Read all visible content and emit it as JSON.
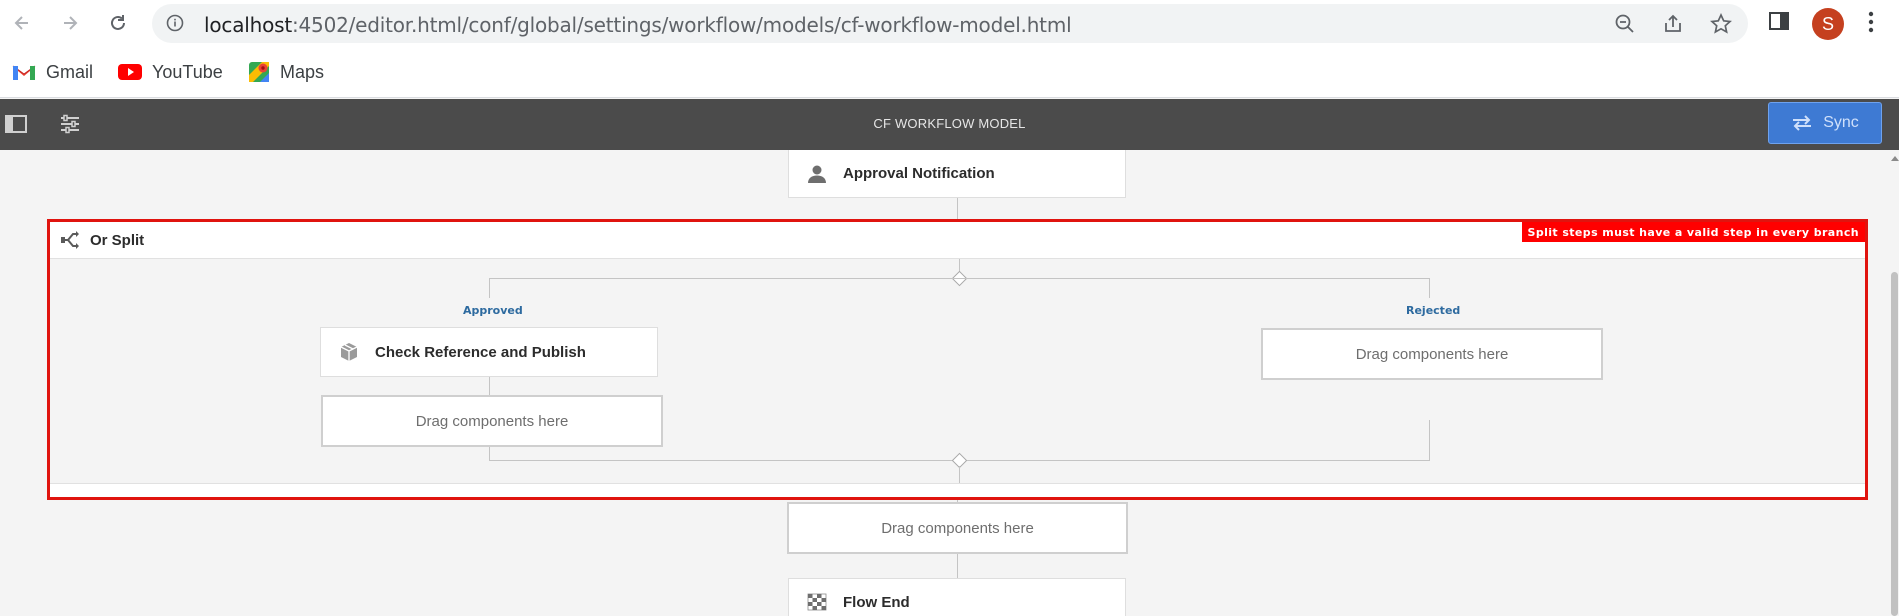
{
  "browser": {
    "url_host": "localhost",
    "url_path": ":4502/editor.html/conf/global/settings/workflow/models/cf-workflow-model.html",
    "avatar_letter": "S",
    "bookmarks": [
      {
        "label": "Gmail",
        "icon": "gmail-icon"
      },
      {
        "label": "YouTube",
        "icon": "youtube-icon"
      },
      {
        "label": "Maps",
        "icon": "maps-icon"
      }
    ]
  },
  "toolbar": {
    "title": "CF WORKFLOW MODEL",
    "sync_label": "Sync",
    "accent": "#3e7ad3"
  },
  "workflow": {
    "approval_step": {
      "label": "Approval Notification",
      "icon": "user-icon"
    },
    "or_split": {
      "label": "Or Split",
      "icon": "split-icon",
      "error": "Split steps must have a valid step in every branch",
      "error_color": "#ff0000",
      "branches": [
        {
          "label": "Approved",
          "step": "Check Reference and Publish",
          "step_icon": "package-icon",
          "drop_label": "Drag components here"
        },
        {
          "label": "Rejected",
          "drop_label": "Drag components here"
        }
      ]
    },
    "after_split_drop": "Drag components here",
    "end_step": {
      "label": "Flow End",
      "icon": "checkered-flag-icon"
    }
  }
}
